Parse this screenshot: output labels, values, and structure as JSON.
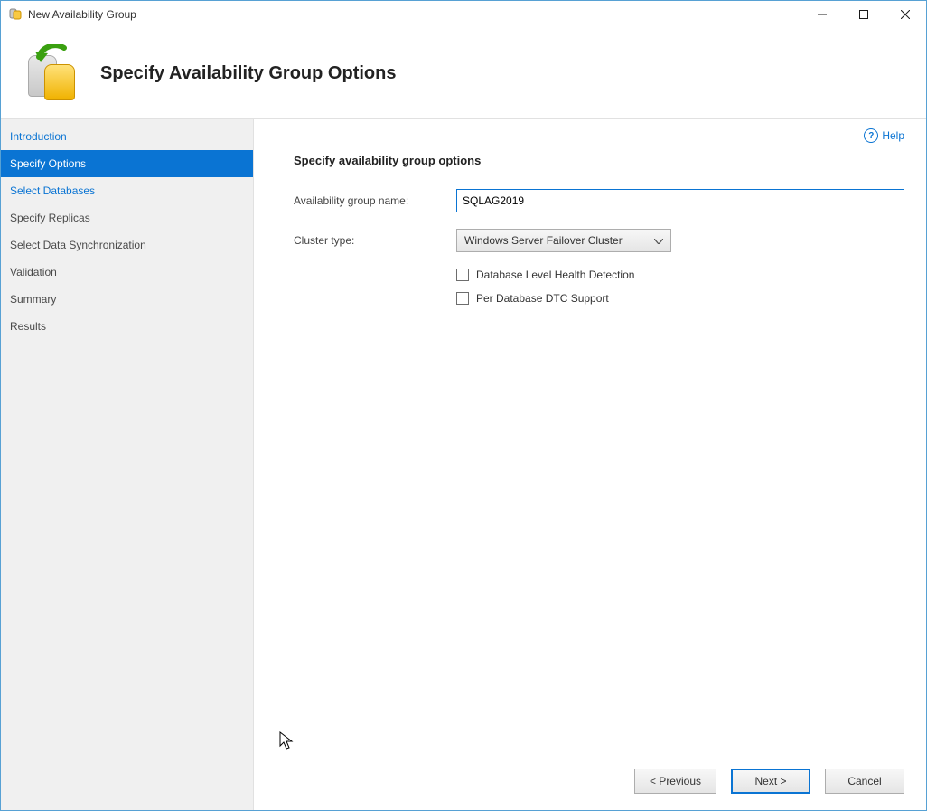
{
  "window": {
    "title": "New Availability Group"
  },
  "header": {
    "title": "Specify Availability Group Options"
  },
  "help": {
    "label": "Help"
  },
  "sidebar": {
    "items": [
      {
        "label": "Introduction"
      },
      {
        "label": "Specify Options"
      },
      {
        "label": "Select Databases"
      },
      {
        "label": "Specify Replicas"
      },
      {
        "label": "Select Data Synchronization"
      },
      {
        "label": "Validation"
      },
      {
        "label": "Summary"
      },
      {
        "label": "Results"
      }
    ]
  },
  "main": {
    "section_heading": "Specify availability group options",
    "ag_name_label": "Availability group name:",
    "ag_name_value": "SQLAG2019",
    "cluster_type_label": "Cluster type:",
    "cluster_type_value": "Windows Server Failover Cluster",
    "check_db_health": "Database Level Health Detection",
    "check_dtc": "Per Database DTC Support"
  },
  "footer": {
    "previous": "< Previous",
    "next": "Next >",
    "cancel": "Cancel"
  }
}
